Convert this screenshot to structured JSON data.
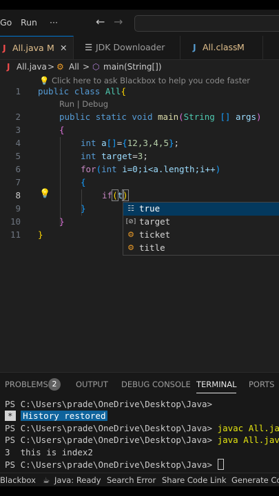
{
  "menu": {
    "items": [
      "Go",
      "Run"
    ],
    "more": "···",
    "back": "←",
    "forward": "→"
  },
  "tabs": [
    {
      "icon": "J",
      "label": "All.java",
      "status": "M",
      "close": "✕"
    },
    {
      "icon": "☰",
      "label": "JDK Downloader"
    },
    {
      "icon": "J",
      "label": "All.class",
      "status": "M"
    }
  ],
  "breadcrumb": {
    "file": "All.java",
    "sep": ">",
    "class_name": "All",
    "method": "main(String[])"
  },
  "editor": {
    "hint": "Click here to ask Blackbox to help you code faster",
    "codelens": "Run | Debug",
    "line_numbers": [
      "1",
      "2",
      "3",
      "4",
      "5",
      "6",
      "7",
      "8",
      "9",
      "10",
      "11"
    ],
    "lines": {
      "l1_kw1": "public",
      "l1_kw2": "class",
      "l1_name": "All",
      "l1_br": "{",
      "l2_kw1": "public",
      "l2_kw2": "static",
      "l2_kw3": "void",
      "l2_fn": "main",
      "l2_open": "(",
      "l2_type": "String",
      "l2_arr": "[]",
      "l2_arg": "args",
      "l2_close": ")",
      "l3_br": "{",
      "l4_kw": "int",
      "l4_var": "a",
      "l4_arr": "[]",
      "l4_eq": "=",
      "l4_open": "{",
      "l4_vals": "12,3,4,5",
      "l4_close": "}",
      "l4_semi": ";",
      "l5_kw": "int",
      "l5_var": "target",
      "l5_eq": "=",
      "l5_val": "3",
      "l5_semi": ";",
      "l6_kw": "for",
      "l6_open": "(",
      "l6_kw2": "int",
      "l6_body": "i=0;i<a.length;i++",
      "l6_close": ")",
      "l7_br": "{",
      "l8_kw": "if",
      "l8_open": "(",
      "l8_text": "t",
      "l8_close": ")",
      "l9_br": "}",
      "l10_br": "}",
      "l11_br": "}"
    }
  },
  "suggestions": [
    {
      "icon": "☷",
      "label": "true"
    },
    {
      "icon": "[⊘]",
      "label": "target"
    },
    {
      "icon": "⚙",
      "label": "ticket"
    },
    {
      "icon": "⚙",
      "label": "title"
    }
  ],
  "panel": {
    "tabs": [
      "PROBLEMS",
      "OUTPUT",
      "DEBUG CONSOLE",
      "TERMINAL",
      "PORTS"
    ],
    "problems_count": "2",
    "active_tab": "TERMINAL"
  },
  "terminal": {
    "prompt": "PS C:\\Users\\prade\\OneDrive\\Desktop\\Java>",
    "restored_star": "*",
    "restored": "History restored",
    "cmd1": "javac All.java",
    "cmd2": "java All.java",
    "output": "3  this is index2"
  },
  "status": {
    "blackbox": "Blackbox",
    "java": "Java: Ready",
    "search_error": "Search Error",
    "share": "Share Code Link",
    "generate": "Generate Co"
  },
  "colors": {
    "accent": "#0078d4",
    "modified": "#e2c08d",
    "java_icon": "#f14c4c"
  }
}
